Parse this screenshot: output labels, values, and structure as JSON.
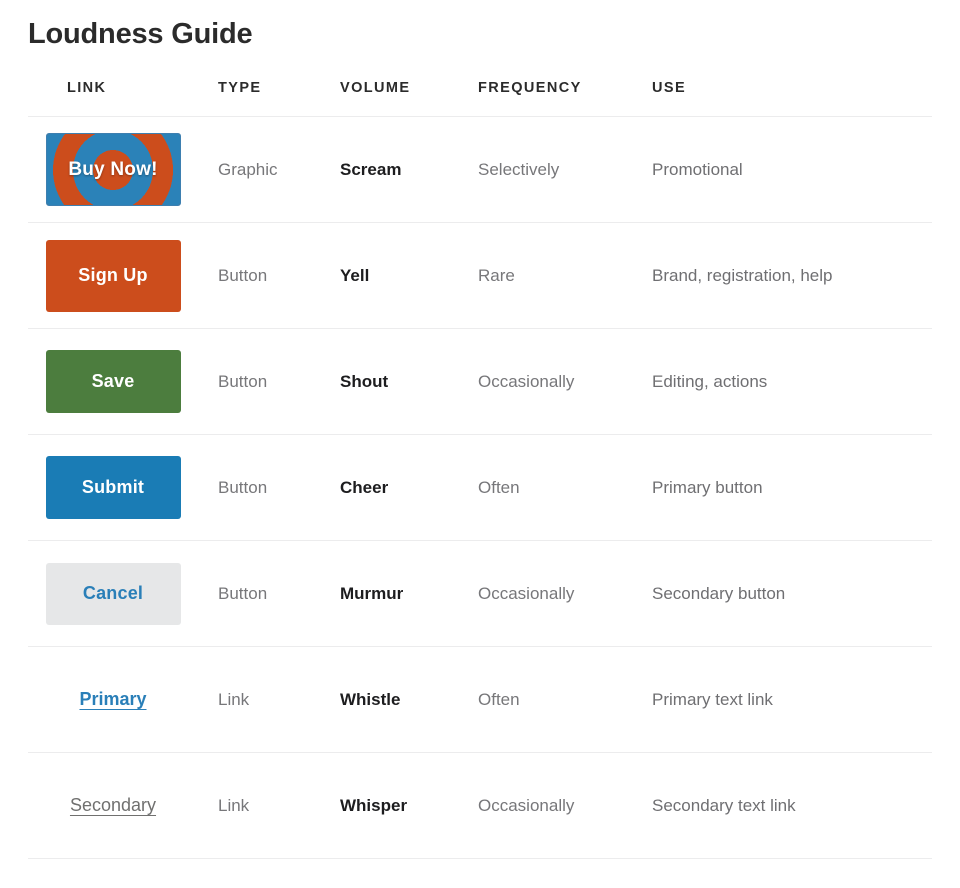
{
  "page": {
    "title": "Loudness Guide"
  },
  "table": {
    "columns": [
      {
        "key": "link",
        "label": "LINK"
      },
      {
        "key": "type",
        "label": "TYPE"
      },
      {
        "key": "volume",
        "label": "VOLUME"
      },
      {
        "key": "frequency",
        "label": "FREQUENCY"
      },
      {
        "key": "use",
        "label": "USE"
      }
    ],
    "rows": [
      {
        "link_label": "Buy Now!",
        "link_style": "graphic-bullseye",
        "type": "Graphic",
        "volume": "Scream",
        "frequency": "Selectively",
        "use": "Promotional"
      },
      {
        "link_label": "Sign Up",
        "link_style": "button-orange",
        "type": "Button",
        "volume": "Yell",
        "frequency": "Rare",
        "use": "Brand, registration, help"
      },
      {
        "link_label": "Save",
        "link_style": "button-green",
        "type": "Button",
        "volume": "Shout",
        "frequency": "Occasionally",
        "use": "Editing, actions"
      },
      {
        "link_label": "Submit",
        "link_style": "button-blue",
        "type": "Button",
        "volume": "Cheer",
        "frequency": "Often",
        "use": "Primary button"
      },
      {
        "link_label": "Cancel",
        "link_style": "button-grey",
        "type": "Button",
        "volume": "Murmur",
        "frequency": "Occasionally",
        "use": "Secondary button"
      },
      {
        "link_label": "Primary",
        "link_style": "link-primary",
        "type": "Link",
        "volume": "Whistle",
        "frequency": "Often",
        "use": "Primary text link"
      },
      {
        "link_label": "Secondary",
        "link_style": "link-secondary",
        "type": "Link",
        "volume": "Whisper",
        "frequency": "Occasionally",
        "use": "Secondary text link"
      }
    ]
  },
  "colors": {
    "orange": "#cc4d1c",
    "green": "#4c7d3e",
    "blue": "#1a7cb5",
    "grey_button_bg": "#e6e7e8",
    "link_blue": "#2a7fb8",
    "ring_blue": "#2b82b8",
    "rule": "#ececed",
    "heading_text": "#2b2b2b",
    "body_text": "#6f6f72"
  }
}
